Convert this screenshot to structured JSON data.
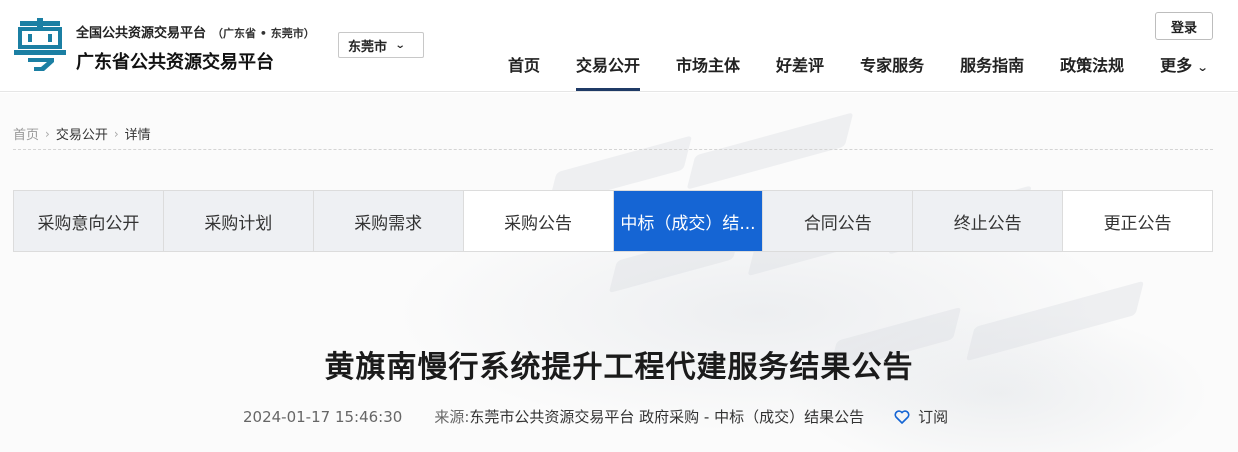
{
  "header": {
    "platform_name": "全国公共资源交易平台",
    "region": "（广东省 • 东莞市）",
    "site_title": "广东省公共资源交易平台",
    "city": "东莞市",
    "login": "登录",
    "logo_icon": "yue-character-logo"
  },
  "nav": [
    {
      "label": "首页",
      "active": false
    },
    {
      "label": "交易公开",
      "active": true
    },
    {
      "label": "市场主体",
      "active": false
    },
    {
      "label": "好差评",
      "active": false
    },
    {
      "label": "专家服务",
      "active": false
    },
    {
      "label": "服务指南",
      "active": false
    },
    {
      "label": "政策法规",
      "active": false
    },
    {
      "label": "更多",
      "active": false
    }
  ],
  "breadcrumb": [
    "首页",
    "交易公开",
    "详情"
  ],
  "tabs": [
    {
      "label": "采购意向公开",
      "state": "gray"
    },
    {
      "label": "采购计划",
      "state": "gray"
    },
    {
      "label": "采购需求",
      "state": "gray"
    },
    {
      "label": "采购公告",
      "state": "white"
    },
    {
      "label": "中标（成交）结...",
      "state": "active"
    },
    {
      "label": "合同公告",
      "state": "gray"
    },
    {
      "label": "终止公告",
      "state": "gray"
    },
    {
      "label": "更正公告",
      "state": "white"
    }
  ],
  "article": {
    "title": "黄旗南慢行系统提升工程代建服务结果公告",
    "date": "2024-01-17 15:46:30",
    "source_label": "来源: ",
    "source": "东莞市公共资源交易平台 政府采购 - 中标（成交）结果公告",
    "subscribe": "订阅"
  },
  "colors": {
    "accent": "#1565d4",
    "nav_underline": "#1f3a66",
    "logo": "#1b7fa3"
  }
}
